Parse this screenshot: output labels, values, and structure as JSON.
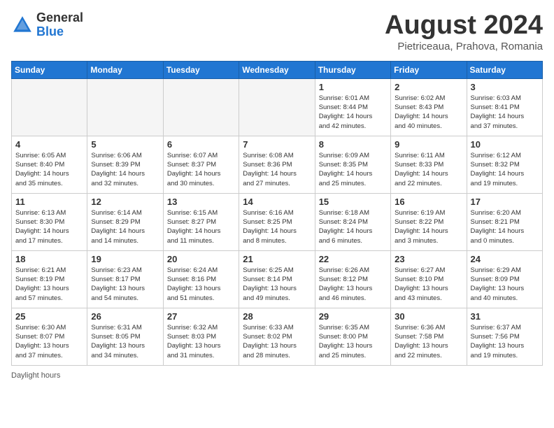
{
  "logo": {
    "general": "General",
    "blue": "Blue"
  },
  "title": "August 2024",
  "location": "Pietriceaua, Prahova, Romania",
  "days_header": [
    "Sunday",
    "Monday",
    "Tuesday",
    "Wednesday",
    "Thursday",
    "Friday",
    "Saturday"
  ],
  "weeks": [
    [
      {
        "day": "",
        "info": ""
      },
      {
        "day": "",
        "info": ""
      },
      {
        "day": "",
        "info": ""
      },
      {
        "day": "",
        "info": ""
      },
      {
        "day": "1",
        "info": "Sunrise: 6:01 AM\nSunset: 8:44 PM\nDaylight: 14 hours\nand 42 minutes."
      },
      {
        "day": "2",
        "info": "Sunrise: 6:02 AM\nSunset: 8:43 PM\nDaylight: 14 hours\nand 40 minutes."
      },
      {
        "day": "3",
        "info": "Sunrise: 6:03 AM\nSunset: 8:41 PM\nDaylight: 14 hours\nand 37 minutes."
      }
    ],
    [
      {
        "day": "4",
        "info": "Sunrise: 6:05 AM\nSunset: 8:40 PM\nDaylight: 14 hours\nand 35 minutes."
      },
      {
        "day": "5",
        "info": "Sunrise: 6:06 AM\nSunset: 8:39 PM\nDaylight: 14 hours\nand 32 minutes."
      },
      {
        "day": "6",
        "info": "Sunrise: 6:07 AM\nSunset: 8:37 PM\nDaylight: 14 hours\nand 30 minutes."
      },
      {
        "day": "7",
        "info": "Sunrise: 6:08 AM\nSunset: 8:36 PM\nDaylight: 14 hours\nand 27 minutes."
      },
      {
        "day": "8",
        "info": "Sunrise: 6:09 AM\nSunset: 8:35 PM\nDaylight: 14 hours\nand 25 minutes."
      },
      {
        "day": "9",
        "info": "Sunrise: 6:11 AM\nSunset: 8:33 PM\nDaylight: 14 hours\nand 22 minutes."
      },
      {
        "day": "10",
        "info": "Sunrise: 6:12 AM\nSunset: 8:32 PM\nDaylight: 14 hours\nand 19 minutes."
      }
    ],
    [
      {
        "day": "11",
        "info": "Sunrise: 6:13 AM\nSunset: 8:30 PM\nDaylight: 14 hours\nand 17 minutes."
      },
      {
        "day": "12",
        "info": "Sunrise: 6:14 AM\nSunset: 8:29 PM\nDaylight: 14 hours\nand 14 minutes."
      },
      {
        "day": "13",
        "info": "Sunrise: 6:15 AM\nSunset: 8:27 PM\nDaylight: 14 hours\nand 11 minutes."
      },
      {
        "day": "14",
        "info": "Sunrise: 6:16 AM\nSunset: 8:25 PM\nDaylight: 14 hours\nand 8 minutes."
      },
      {
        "day": "15",
        "info": "Sunrise: 6:18 AM\nSunset: 8:24 PM\nDaylight: 14 hours\nand 6 minutes."
      },
      {
        "day": "16",
        "info": "Sunrise: 6:19 AM\nSunset: 8:22 PM\nDaylight: 14 hours\nand 3 minutes."
      },
      {
        "day": "17",
        "info": "Sunrise: 6:20 AM\nSunset: 8:21 PM\nDaylight: 14 hours\nand 0 minutes."
      }
    ],
    [
      {
        "day": "18",
        "info": "Sunrise: 6:21 AM\nSunset: 8:19 PM\nDaylight: 13 hours\nand 57 minutes."
      },
      {
        "day": "19",
        "info": "Sunrise: 6:23 AM\nSunset: 8:17 PM\nDaylight: 13 hours\nand 54 minutes."
      },
      {
        "day": "20",
        "info": "Sunrise: 6:24 AM\nSunset: 8:16 PM\nDaylight: 13 hours\nand 51 minutes."
      },
      {
        "day": "21",
        "info": "Sunrise: 6:25 AM\nSunset: 8:14 PM\nDaylight: 13 hours\nand 49 minutes."
      },
      {
        "day": "22",
        "info": "Sunrise: 6:26 AM\nSunset: 8:12 PM\nDaylight: 13 hours\nand 46 minutes."
      },
      {
        "day": "23",
        "info": "Sunrise: 6:27 AM\nSunset: 8:10 PM\nDaylight: 13 hours\nand 43 minutes."
      },
      {
        "day": "24",
        "info": "Sunrise: 6:29 AM\nSunset: 8:09 PM\nDaylight: 13 hours\nand 40 minutes."
      }
    ],
    [
      {
        "day": "25",
        "info": "Sunrise: 6:30 AM\nSunset: 8:07 PM\nDaylight: 13 hours\nand 37 minutes."
      },
      {
        "day": "26",
        "info": "Sunrise: 6:31 AM\nSunset: 8:05 PM\nDaylight: 13 hours\nand 34 minutes."
      },
      {
        "day": "27",
        "info": "Sunrise: 6:32 AM\nSunset: 8:03 PM\nDaylight: 13 hours\nand 31 minutes."
      },
      {
        "day": "28",
        "info": "Sunrise: 6:33 AM\nSunset: 8:02 PM\nDaylight: 13 hours\nand 28 minutes."
      },
      {
        "day": "29",
        "info": "Sunrise: 6:35 AM\nSunset: 8:00 PM\nDaylight: 13 hours\nand 25 minutes."
      },
      {
        "day": "30",
        "info": "Sunrise: 6:36 AM\nSunset: 7:58 PM\nDaylight: 13 hours\nand 22 minutes."
      },
      {
        "day": "31",
        "info": "Sunrise: 6:37 AM\nSunset: 7:56 PM\nDaylight: 13 hours\nand 19 minutes."
      }
    ]
  ],
  "footer": "Daylight hours"
}
